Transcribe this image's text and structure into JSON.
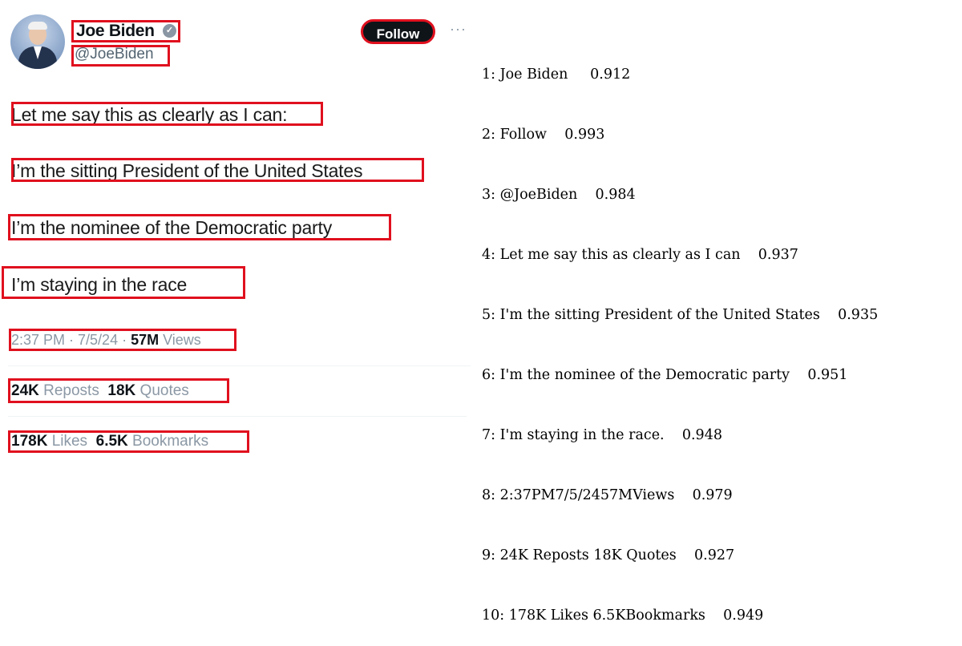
{
  "tweet": {
    "author_name": "Joe Biden",
    "handle": "@JoeBiden",
    "follow_label": "Follow",
    "more_glyph": "···",
    "verified_glyph": "✓",
    "lines": [
      "Let me say this as clearly as I can:",
      "I’m the sitting President of the United States",
      "I’m the nominee of the Democratic party",
      "I’m staying in the race"
    ],
    "timestamp": "2:37 PM · 7/5/24 · ",
    "views_count": "57M",
    "views_label": " Views",
    "reposts_count": "24K",
    "reposts_label": " Reposts",
    "quotes_count": "18K",
    "quotes_label": " Quotes",
    "likes_count": "178K",
    "likes_label": " Likes",
    "bookmarks_count": "6.5K",
    "bookmarks_label": " Bookmarks"
  },
  "detections": [
    "1: Joe Biden     0.912",
    "2: Follow    0.993",
    "3: @JoeBiden    0.984",
    "4: Let me say this as clearly as I can    0.937",
    "5: I'm the sitting President of the United States    0.935",
    "6: I'm the nominee of the Democratic party    0.951",
    "7: I'm staying in the race.    0.948",
    "8: 2:37PM7/5/2457MViews    0.979",
    "9: 24K Reposts 18K Quotes    0.927",
    "10: 178K Likes 6.5KBookmarks    0.949"
  ],
  "colors": {
    "box": "#e0101e",
    "button": "#0f1419",
    "muted": "#8b98a5"
  }
}
